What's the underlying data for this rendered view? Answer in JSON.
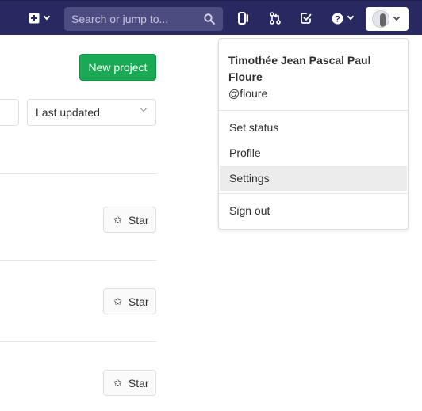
{
  "navbar": {
    "search_placeholder": "Search or jump to..."
  },
  "main": {
    "new_project_label": "New project",
    "sort_value": "Last updated",
    "star_label": "Star"
  },
  "user_menu": {
    "name": "Timothée Jean Pascal Paul Floure",
    "handle": "@floure",
    "items": [
      {
        "label": "Set status"
      },
      {
        "label": "Profile"
      },
      {
        "label": "Settings"
      },
      {
        "label": "Sign out"
      }
    ]
  },
  "colors": {
    "navbar": "#292961",
    "primary_button": "#1aaa55",
    "active_item": "#ececec"
  }
}
